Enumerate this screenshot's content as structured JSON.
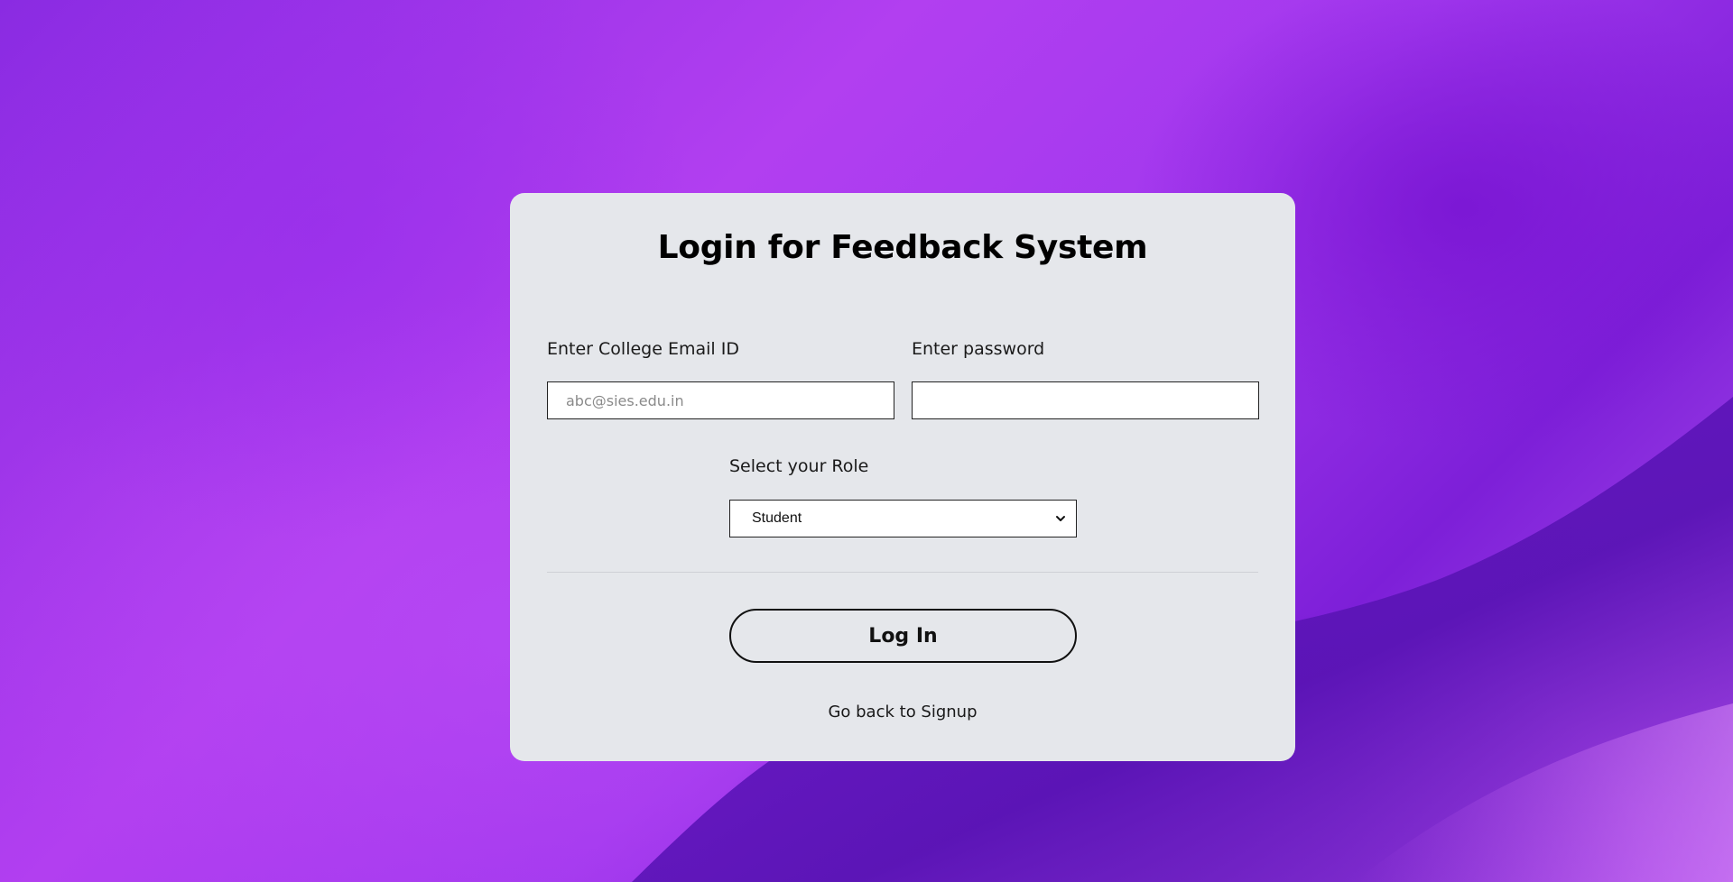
{
  "page": {
    "title": "Login for Feedback System"
  },
  "email": {
    "label": "Enter College Email ID",
    "placeholder": "abc@sies.edu.in",
    "value": ""
  },
  "password": {
    "label": "Enter password",
    "value": ""
  },
  "role": {
    "label": "Select your Role",
    "selected": "Student",
    "icon": "chevron-down-icon"
  },
  "actions": {
    "login_label": "Log In",
    "signup_link": "Go back to Signup"
  },
  "colors": {
    "card_background": "#e5e7eb",
    "background_primary": "#a238ee",
    "background_dark": "#7d1fd8",
    "text": "#111111"
  }
}
